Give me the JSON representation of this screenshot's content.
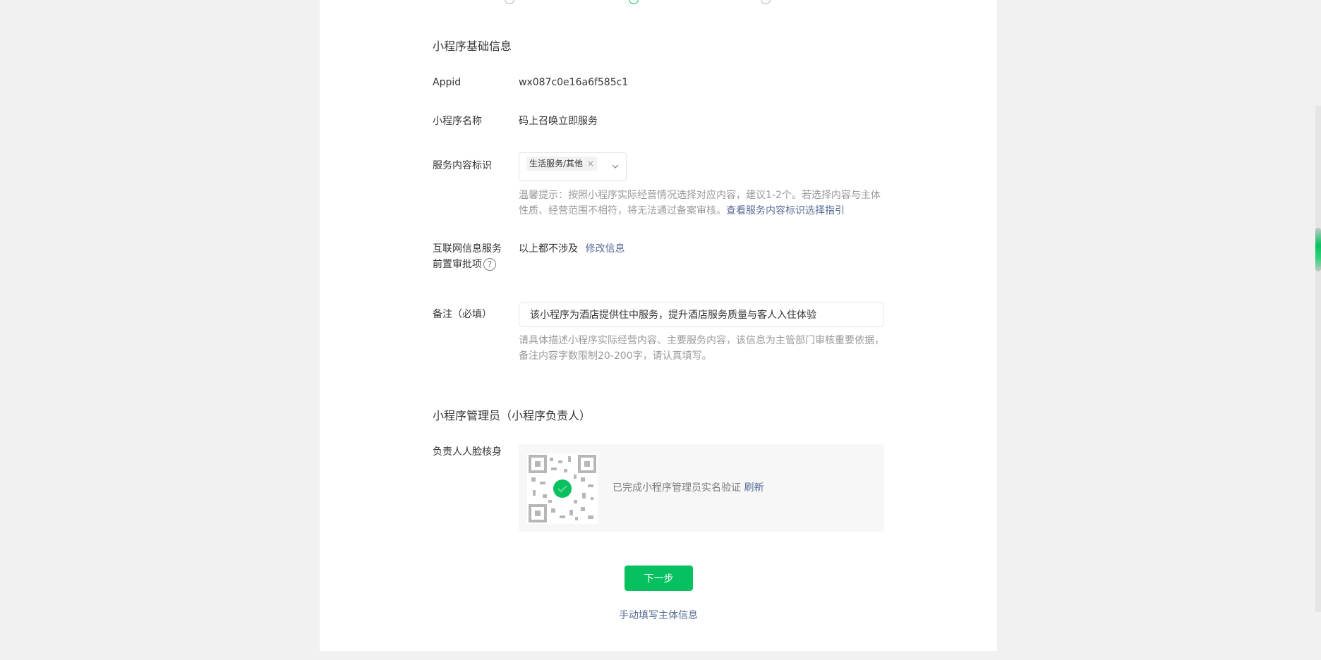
{
  "colors": {
    "primary": "#07c160",
    "link": "#576b95",
    "page_bg": "#f1f1f1"
  },
  "basic_info": {
    "title": "小程序基础信息",
    "appid_label": "Appid",
    "appid_value": "wx087c0e16a6f585c1",
    "name_label": "小程序名称",
    "name_value": "码上召唤立即服务",
    "service_label": "服务内容标识",
    "service_tag": "生活服务/其他",
    "service_hint": "温馨提示：按照小程序实际经营情况选择对应内容，建议1-2个。若选择内容与主体性质、经营范围不相符，将无法通过备案审核。",
    "service_hint_link": "查看服务内容标识选择指引",
    "approval_label_line1": "互联网信息服务",
    "approval_label_line2": "前置审批项",
    "approval_value": "以上都不涉及",
    "approval_edit_link": "修改信息",
    "remark_label": "备注（必填）",
    "remark_value": "该小程序为酒店提供住中服务，提升酒店服务质量与客人入住体验",
    "remark_hint": "请具体描述小程序实际经营内容、主要服务内容，该信息为主管部门审核重要依据，备注内容字数限制20-200字，请认真填写。"
  },
  "admin": {
    "title": "小程序管理员（小程序负责人）",
    "face_label": "负责人人脸核身",
    "verify_text": "已完成小程序管理员实名验证",
    "refresh_link": "刷新"
  },
  "actions": {
    "next_label": "下一步",
    "manual_link": "手动填写主体信息"
  },
  "icons": {
    "tag_close": "×",
    "help": "?"
  }
}
